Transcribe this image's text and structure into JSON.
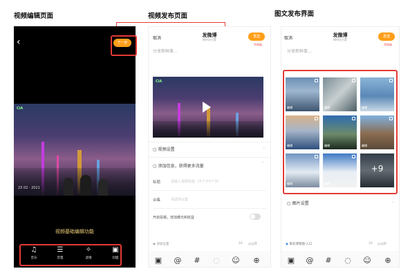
{
  "captions": {
    "video_edit": "视频编辑页面",
    "video_publish": "视频发布页面",
    "image_publish": "图文发布界面"
  },
  "editor": {
    "next_label": "下一步",
    "date_text": "23  02 · 2021",
    "feature_label": "视频基础编辑功能",
    "tools": [
      {
        "icon": "music-icon",
        "glyph": "♫",
        "label": "音乐"
      },
      {
        "icon": "volume-icon",
        "glyph": "☰",
        "label": "音量"
      },
      {
        "icon": "filter-icon",
        "glyph": "✧",
        "label": "滤镜"
      },
      {
        "icon": "cover-icon",
        "glyph": "▣",
        "label": "封面"
      }
    ]
  },
  "video_publish": {
    "cancel": "取消",
    "title": "发微博",
    "subtitle": "WHO小李",
    "send": "发送",
    "draft": "草稿箱",
    "placeholder": "分享新鲜事...",
    "video_settings": "视频设置",
    "add_info": "添加信息，获得更多流量",
    "title_label": "标题",
    "title_placeholder": "请输入视频标题（不少于6个字）",
    "collection_label": "合集",
    "collection_placeholder": "请选择合集",
    "monetize": "开启投稿，增加曝光和收益",
    "location": "添加位置",
    "count": "10",
    "visibility": "公开"
  },
  "image_publish": {
    "cancel": "取消",
    "title": "发微博",
    "subtitle": "WHO小李",
    "send": "发送",
    "draft": "草稿箱",
    "placeholder": "分享新鲜事...",
    "cell_label": "编辑",
    "more_count": "+9",
    "image_settings": "图片设置",
    "location": "目前博客圈·入口",
    "count": "10",
    "visibility": "公开"
  },
  "colors": {
    "accent": "#ff9f1a",
    "highlight": "#e53935"
  }
}
